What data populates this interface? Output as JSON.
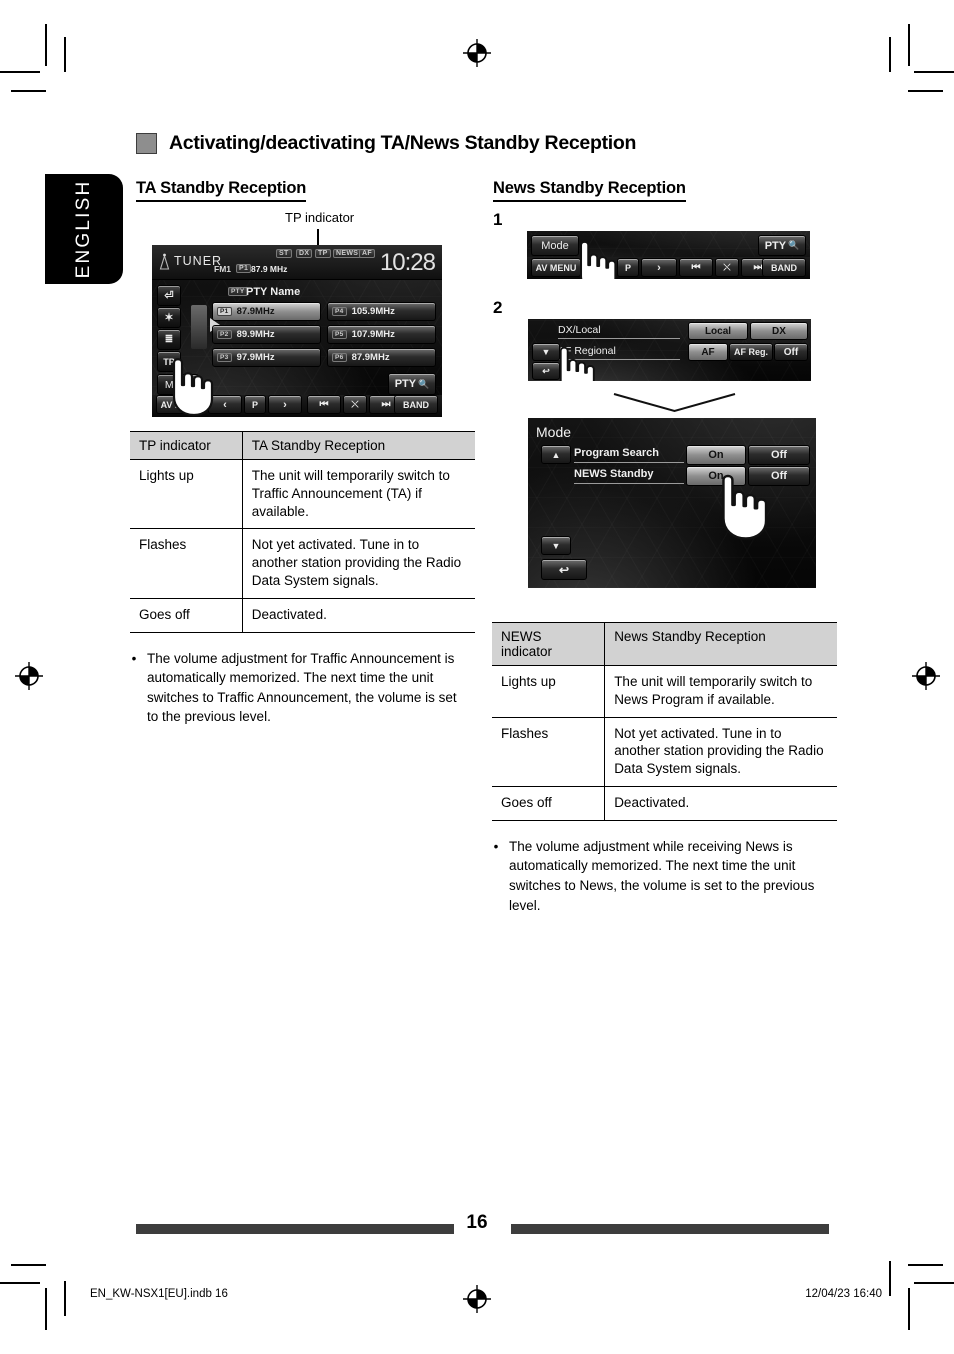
{
  "language_tab": "ENGLISH",
  "section": {
    "heading": "Activating/deactivating TA/News Standby Reception"
  },
  "left_column": {
    "subheading": "TA Standby Reception",
    "callout": "TP indicator",
    "tuner_screen": {
      "source_icon": "antenna-icon",
      "source_label": "TUNER",
      "band_label": "FM1",
      "preset_badge": "P1",
      "frequency": "87.9 MHz",
      "clock": "10:28",
      "indicators": [
        "ST",
        "DX",
        "TP",
        "NEWS",
        "AF"
      ],
      "pty_row_badge": "PTY",
      "pty_row_label": "PTY Name",
      "side_icons": [
        "return-icon",
        "bluetooth-icon",
        "equalizer-icon"
      ],
      "tp_button": "TP",
      "mode_button": "Mode",
      "presets": [
        {
          "badge": "P1",
          "label": "87.9MHz",
          "selected": true
        },
        {
          "badge": "P4",
          "label": "105.9MHz",
          "selected": false
        },
        {
          "badge": "P2",
          "label": "89.9MHz",
          "selected": false
        },
        {
          "badge": "P5",
          "label": "107.9MHz",
          "selected": false
        },
        {
          "badge": "P3",
          "label": "97.9MHz",
          "selected": false
        },
        {
          "badge": "P6",
          "label": "87.9MHz",
          "selected": false
        }
      ],
      "pty_search_button": "PTY",
      "bottom_bar": [
        "AV MENU",
        "prev-icon",
        "P",
        "next-icon",
        "track-back-icon",
        "random-icon",
        "track-fwd-icon",
        "BAND"
      ]
    },
    "table": {
      "headers": [
        "TP indicator",
        "TA Standby Reception"
      ],
      "rows": [
        [
          "Lights up",
          "The unit will temporarily switch to Traffic Announcement (TA) if available."
        ],
        [
          "Flashes",
          "Not yet activated. Tune in to another station providing the Radio Data System signals."
        ],
        [
          "Goes off",
          "Deactivated."
        ]
      ]
    },
    "bullet": "The volume adjustment for Traffic Announcement is automatically memorized. The next time the unit switches to Traffic Announcement, the volume is set to the previous level."
  },
  "right_column": {
    "subheading": "News Standby Reception",
    "step1_number": "1",
    "step2_number": "2",
    "step1_screen": {
      "mode_button": "Mode",
      "pty_button": "PTY",
      "bottom_bar": [
        "AV MENU",
        "P",
        "next-icon",
        "track-back-icon",
        "random-icon",
        "track-fwd-icon",
        "BAND"
      ]
    },
    "step2_screen_a": {
      "rows": [
        {
          "label": "DX/Local",
          "options": [
            {
              "text": "Local",
              "selected": false
            },
            {
              "text": "DX",
              "selected": true
            }
          ]
        },
        {
          "label": "AF Regional",
          "options": [
            {
              "text": "AF",
              "selected": true
            },
            {
              "text": "AF Reg.",
              "selected": false
            },
            {
              "text": "Off",
              "selected": false
            }
          ]
        }
      ],
      "down_arrow": "chevron-down-icon",
      "back_button": "back-arrow-icon"
    },
    "step2_screen_b": {
      "title": "Mode",
      "up_arrow": "chevron-up-icon",
      "down_arrow": "chevron-down-icon",
      "back_button": "back-arrow-icon",
      "rows": [
        {
          "label": "Program Search",
          "options": [
            {
              "text": "On",
              "selected": true
            },
            {
              "text": "Off",
              "selected": false
            }
          ]
        },
        {
          "label": "NEWS Standby",
          "options": [
            {
              "text": "On",
              "selected": true
            },
            {
              "text": "Off",
              "selected": false
            }
          ]
        }
      ]
    },
    "table": {
      "headers": [
        "NEWS indicator",
        "News Standby Reception"
      ],
      "rows": [
        [
          "Lights up",
          "The unit will temporarily switch to News Program if available."
        ],
        [
          "Flashes",
          "Not yet activated. Tune in to another station providing the Radio Data System signals."
        ],
        [
          "Goes off",
          "Deactivated."
        ]
      ]
    },
    "bullet": "The volume adjustment while receiving News is automatically memorized. The next time the unit switches to News, the volume is set to the previous level."
  },
  "footer": {
    "page_number": "16",
    "file_name": "EN_KW-NSX1[EU].indb   16",
    "timestamp": "12/04/23   16:40"
  }
}
